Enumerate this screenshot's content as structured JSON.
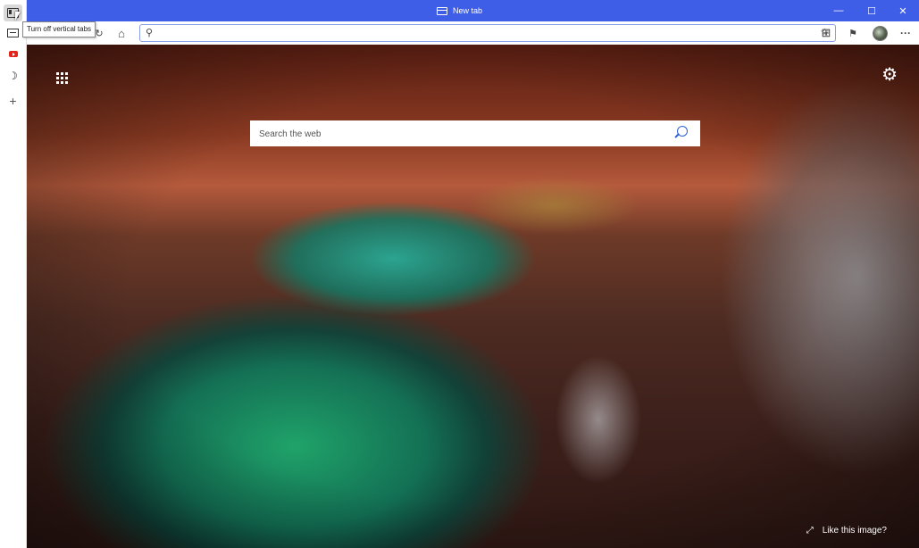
{
  "window": {
    "tab_title": "New tab",
    "minimize_glyph": "—",
    "maximize_glyph": "☐",
    "close_glyph": "✕"
  },
  "vertical_tabs": {
    "tooltip": "Turn off vertical tabs",
    "items": [
      {
        "icon": "vertical-tabs-icon"
      },
      {
        "icon": "tab-icon"
      },
      {
        "icon": "youtube-icon"
      },
      {
        "icon": "moon-icon"
      },
      {
        "icon": "plus-icon",
        "label": "+"
      }
    ]
  },
  "toolbar": {
    "refresh_glyph": "↻",
    "home_glyph": "⌂",
    "address_placeholder": "",
    "search_glyph": "⚲",
    "favorite_glyph": "☆",
    "collections_glyph": "⊞",
    "feedback_glyph": "⚑",
    "menu_glyph": "···"
  },
  "new_tab_page": {
    "search_placeholder": "Search the web",
    "like_image_label": "Like this image?",
    "expand_glyph": "⤢",
    "settings_glyph": "⚙"
  },
  "colors": {
    "titlebar": "#3f5ee8",
    "search_icon": "#2a5fd6"
  }
}
